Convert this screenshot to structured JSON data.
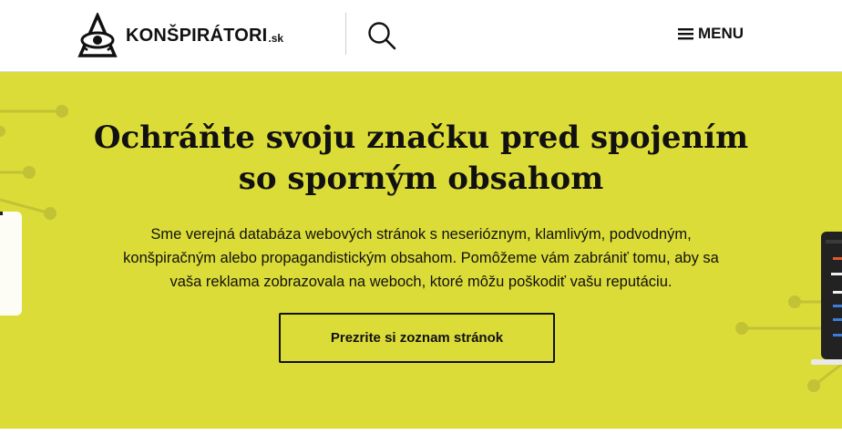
{
  "header": {
    "logo": {
      "name": "KONŠPIRÁTORI",
      "suffix": ".sk",
      "icon": "eye-triangle-icon"
    },
    "search": {
      "icon": "search-icon"
    },
    "menu": {
      "icon": "hamburger-icon",
      "label": "MENU"
    }
  },
  "hero": {
    "title_line1": "Ochráňte svoju značku pred spojením",
    "title_line2": "so sporným obsahom",
    "text_line1": "Sme verejná databáza webových stránok s neserióznym, klamlivým, podvodným,",
    "text_line2": "konšpiračným alebo propagandistickým obsahom. Pomôžeme vám zabrániť tomu, aby sa",
    "text_line3": "vaša reklama zobrazovala na weboch, ktoré môžu poškodiť vašu reputáciu.",
    "cta_label": "Prezrite si zoznam stránok"
  },
  "colors": {
    "hero_background": "#dcdc38",
    "text": "#111111",
    "decoration_lines": "#c2c236"
  }
}
